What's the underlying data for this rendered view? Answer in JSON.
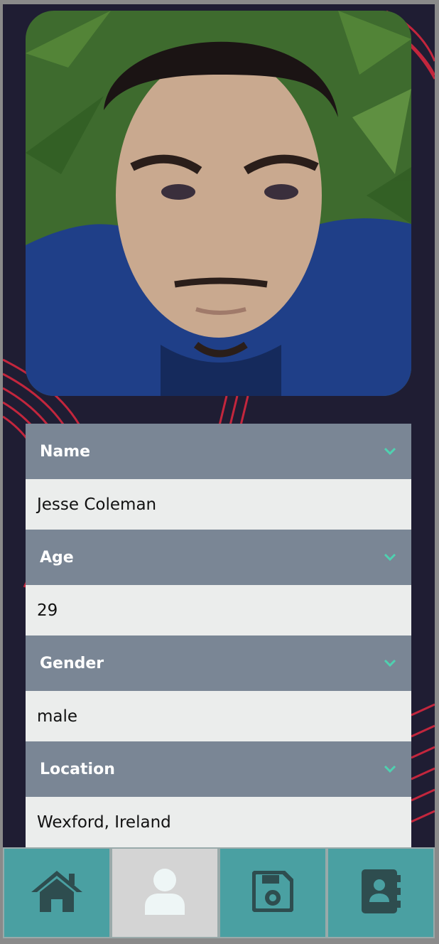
{
  "profile": {
    "photo_alt": "Profile photo",
    "fields": [
      {
        "label": "Name",
        "value": "Jesse Coleman"
      },
      {
        "label": "Age",
        "value": "29"
      },
      {
        "label": "Gender",
        "value": "male"
      },
      {
        "label": "Location",
        "value": "Wexford, Ireland"
      }
    ]
  },
  "nav": {
    "items": [
      {
        "icon": "home-icon",
        "active": false
      },
      {
        "icon": "user-icon",
        "active": true
      },
      {
        "icon": "save-icon",
        "active": false
      },
      {
        "icon": "contacts-icon",
        "active": false
      }
    ]
  },
  "colors": {
    "background": "#1f1d33",
    "header": "#7a8695",
    "row": "#ebedec",
    "nav": "#4aa0a2",
    "nav_active": "#d4d4d4",
    "chevron": "#4fd1b0",
    "accent_lines": "#e0283f"
  }
}
